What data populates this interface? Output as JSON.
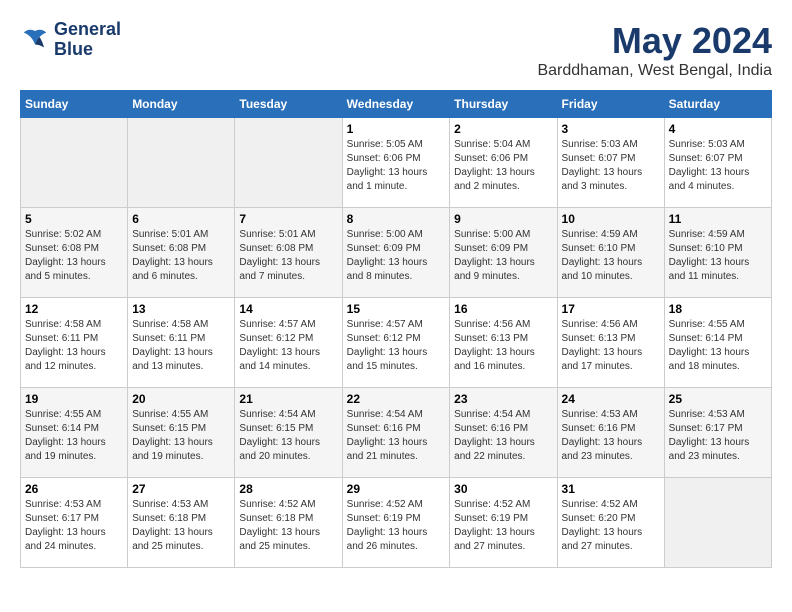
{
  "header": {
    "logo_line1": "General",
    "logo_line2": "Blue",
    "month": "May 2024",
    "location": "Barddhaman, West Bengal, India"
  },
  "weekdays": [
    "Sunday",
    "Monday",
    "Tuesday",
    "Wednesday",
    "Thursday",
    "Friday",
    "Saturday"
  ],
  "weeks": [
    [
      {
        "day": "",
        "sunrise": "",
        "sunset": "",
        "daylight": "",
        "empty": true
      },
      {
        "day": "",
        "sunrise": "",
        "sunset": "",
        "daylight": "",
        "empty": true
      },
      {
        "day": "",
        "sunrise": "",
        "sunset": "",
        "daylight": "",
        "empty": true
      },
      {
        "day": "1",
        "sunrise": "Sunrise: 5:05 AM",
        "sunset": "Sunset: 6:06 PM",
        "daylight": "Daylight: 13 hours and 1 minute."
      },
      {
        "day": "2",
        "sunrise": "Sunrise: 5:04 AM",
        "sunset": "Sunset: 6:06 PM",
        "daylight": "Daylight: 13 hours and 2 minutes."
      },
      {
        "day": "3",
        "sunrise": "Sunrise: 5:03 AM",
        "sunset": "Sunset: 6:07 PM",
        "daylight": "Daylight: 13 hours and 3 minutes."
      },
      {
        "day": "4",
        "sunrise": "Sunrise: 5:03 AM",
        "sunset": "Sunset: 6:07 PM",
        "daylight": "Daylight: 13 hours and 4 minutes."
      }
    ],
    [
      {
        "day": "5",
        "sunrise": "Sunrise: 5:02 AM",
        "sunset": "Sunset: 6:08 PM",
        "daylight": "Daylight: 13 hours and 5 minutes."
      },
      {
        "day": "6",
        "sunrise": "Sunrise: 5:01 AM",
        "sunset": "Sunset: 6:08 PM",
        "daylight": "Daylight: 13 hours and 6 minutes."
      },
      {
        "day": "7",
        "sunrise": "Sunrise: 5:01 AM",
        "sunset": "Sunset: 6:08 PM",
        "daylight": "Daylight: 13 hours and 7 minutes."
      },
      {
        "day": "8",
        "sunrise": "Sunrise: 5:00 AM",
        "sunset": "Sunset: 6:09 PM",
        "daylight": "Daylight: 13 hours and 8 minutes."
      },
      {
        "day": "9",
        "sunrise": "Sunrise: 5:00 AM",
        "sunset": "Sunset: 6:09 PM",
        "daylight": "Daylight: 13 hours and 9 minutes."
      },
      {
        "day": "10",
        "sunrise": "Sunrise: 4:59 AM",
        "sunset": "Sunset: 6:10 PM",
        "daylight": "Daylight: 13 hours and 10 minutes."
      },
      {
        "day": "11",
        "sunrise": "Sunrise: 4:59 AM",
        "sunset": "Sunset: 6:10 PM",
        "daylight": "Daylight: 13 hours and 11 minutes."
      }
    ],
    [
      {
        "day": "12",
        "sunrise": "Sunrise: 4:58 AM",
        "sunset": "Sunset: 6:11 PM",
        "daylight": "Daylight: 13 hours and 12 minutes."
      },
      {
        "day": "13",
        "sunrise": "Sunrise: 4:58 AM",
        "sunset": "Sunset: 6:11 PM",
        "daylight": "Daylight: 13 hours and 13 minutes."
      },
      {
        "day": "14",
        "sunrise": "Sunrise: 4:57 AM",
        "sunset": "Sunset: 6:12 PM",
        "daylight": "Daylight: 13 hours and 14 minutes."
      },
      {
        "day": "15",
        "sunrise": "Sunrise: 4:57 AM",
        "sunset": "Sunset: 6:12 PM",
        "daylight": "Daylight: 13 hours and 15 minutes."
      },
      {
        "day": "16",
        "sunrise": "Sunrise: 4:56 AM",
        "sunset": "Sunset: 6:13 PM",
        "daylight": "Daylight: 13 hours and 16 minutes."
      },
      {
        "day": "17",
        "sunrise": "Sunrise: 4:56 AM",
        "sunset": "Sunset: 6:13 PM",
        "daylight": "Daylight: 13 hours and 17 minutes."
      },
      {
        "day": "18",
        "sunrise": "Sunrise: 4:55 AM",
        "sunset": "Sunset: 6:14 PM",
        "daylight": "Daylight: 13 hours and 18 minutes."
      }
    ],
    [
      {
        "day": "19",
        "sunrise": "Sunrise: 4:55 AM",
        "sunset": "Sunset: 6:14 PM",
        "daylight": "Daylight: 13 hours and 19 minutes."
      },
      {
        "day": "20",
        "sunrise": "Sunrise: 4:55 AM",
        "sunset": "Sunset: 6:15 PM",
        "daylight": "Daylight: 13 hours and 19 minutes."
      },
      {
        "day": "21",
        "sunrise": "Sunrise: 4:54 AM",
        "sunset": "Sunset: 6:15 PM",
        "daylight": "Daylight: 13 hours and 20 minutes."
      },
      {
        "day": "22",
        "sunrise": "Sunrise: 4:54 AM",
        "sunset": "Sunset: 6:16 PM",
        "daylight": "Daylight: 13 hours and 21 minutes."
      },
      {
        "day": "23",
        "sunrise": "Sunrise: 4:54 AM",
        "sunset": "Sunset: 6:16 PM",
        "daylight": "Daylight: 13 hours and 22 minutes."
      },
      {
        "day": "24",
        "sunrise": "Sunrise: 4:53 AM",
        "sunset": "Sunset: 6:16 PM",
        "daylight": "Daylight: 13 hours and 23 minutes."
      },
      {
        "day": "25",
        "sunrise": "Sunrise: 4:53 AM",
        "sunset": "Sunset: 6:17 PM",
        "daylight": "Daylight: 13 hours and 23 minutes."
      }
    ],
    [
      {
        "day": "26",
        "sunrise": "Sunrise: 4:53 AM",
        "sunset": "Sunset: 6:17 PM",
        "daylight": "Daylight: 13 hours and 24 minutes."
      },
      {
        "day": "27",
        "sunrise": "Sunrise: 4:53 AM",
        "sunset": "Sunset: 6:18 PM",
        "daylight": "Daylight: 13 hours and 25 minutes."
      },
      {
        "day": "28",
        "sunrise": "Sunrise: 4:52 AM",
        "sunset": "Sunset: 6:18 PM",
        "daylight": "Daylight: 13 hours and 25 minutes."
      },
      {
        "day": "29",
        "sunrise": "Sunrise: 4:52 AM",
        "sunset": "Sunset: 6:19 PM",
        "daylight": "Daylight: 13 hours and 26 minutes."
      },
      {
        "day": "30",
        "sunrise": "Sunrise: 4:52 AM",
        "sunset": "Sunset: 6:19 PM",
        "daylight": "Daylight: 13 hours and 27 minutes."
      },
      {
        "day": "31",
        "sunrise": "Sunrise: 4:52 AM",
        "sunset": "Sunset: 6:20 PM",
        "daylight": "Daylight: 13 hours and 27 minutes."
      },
      {
        "day": "",
        "sunrise": "",
        "sunset": "",
        "daylight": "",
        "empty": true
      }
    ]
  ]
}
